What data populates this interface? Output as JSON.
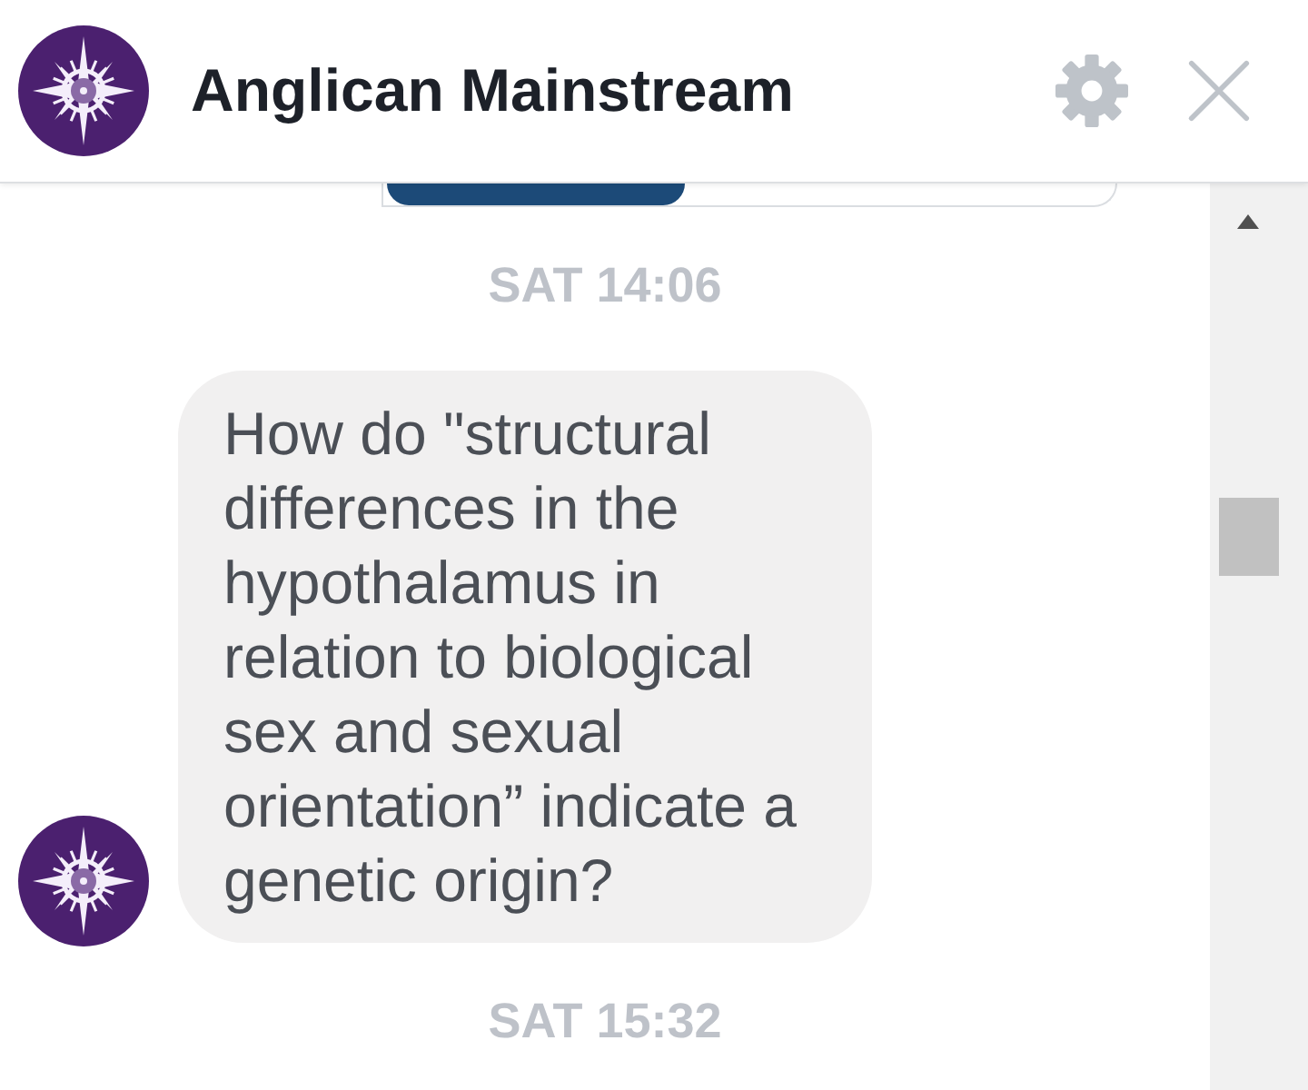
{
  "header": {
    "title": "Anglican Mainstream"
  },
  "thread": [
    {
      "kind": "card_cutoff"
    },
    {
      "kind": "timestamp",
      "text": "SAT 14:06"
    },
    {
      "kind": "message",
      "text": "How do \"structural differences in the hypothalamus in relation to biological sex and sexual orientation” indicate a genetic origin?"
    },
    {
      "kind": "timestamp",
      "text": "SAT 15:32"
    }
  ]
}
